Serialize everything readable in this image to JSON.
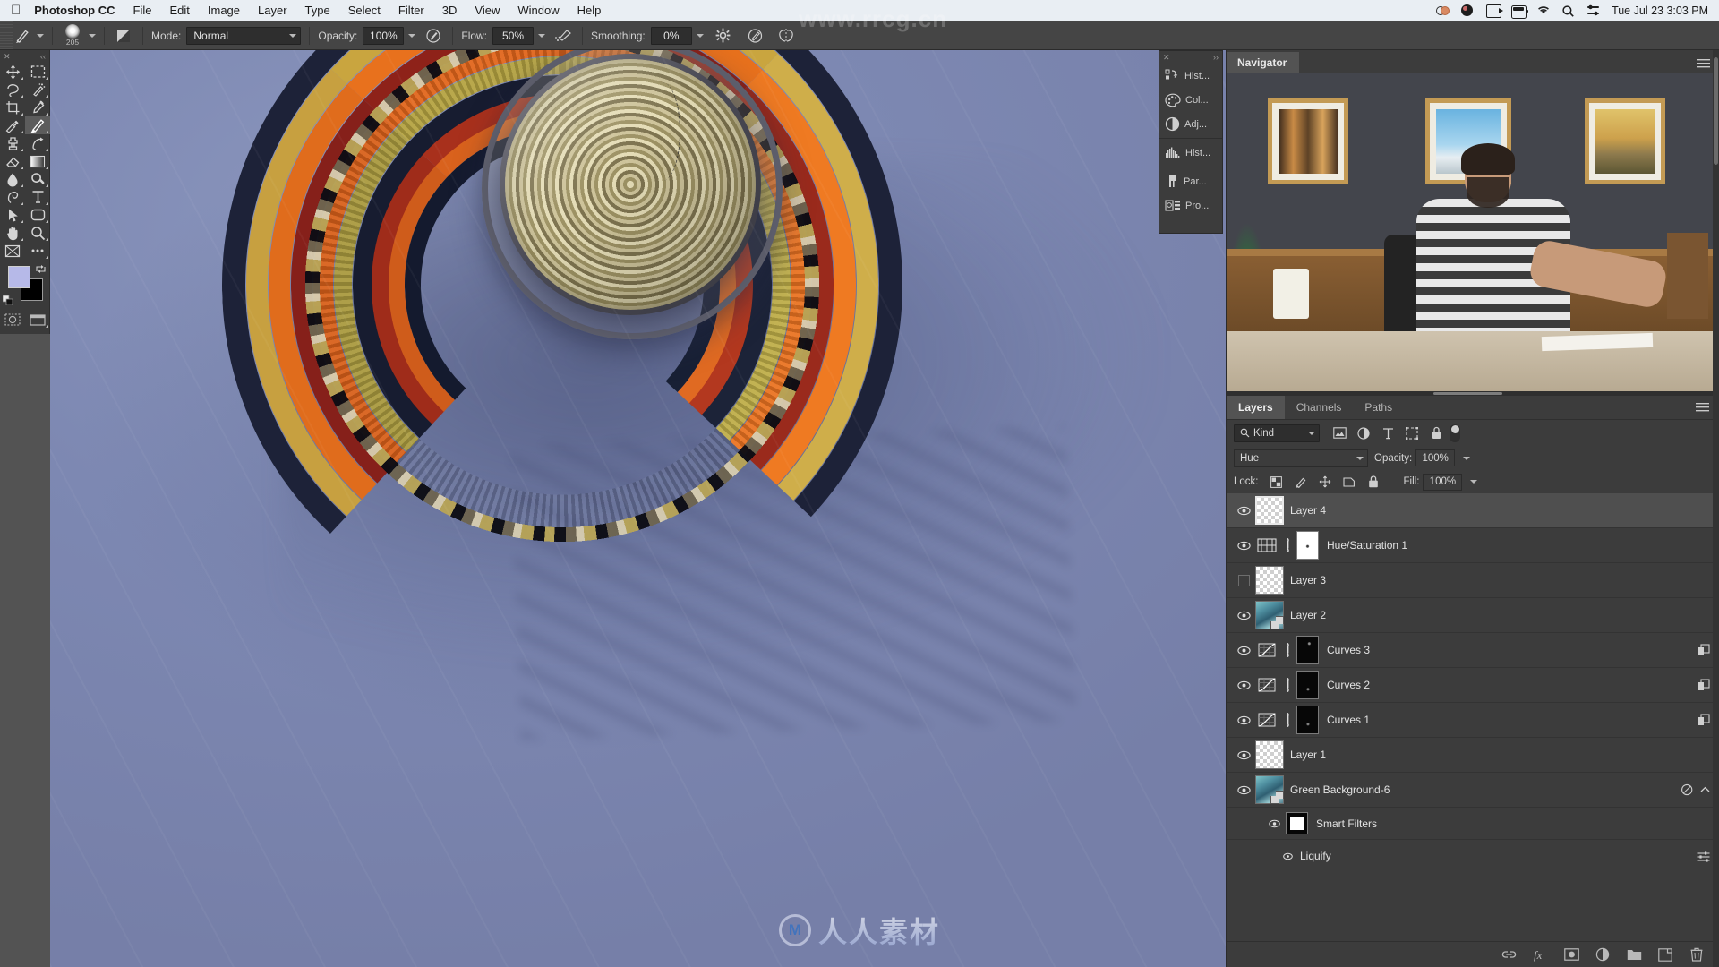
{
  "menubar": {
    "app_name": "Photoshop CC",
    "items": [
      "File",
      "Edit",
      "Image",
      "Layer",
      "Type",
      "Select",
      "Filter",
      "3D",
      "View",
      "Window",
      "Help"
    ],
    "clock": "Tue Jul 23  3:03 PM",
    "status_icons": [
      "dropbox-icon",
      "colorsync-icon",
      "airplay-icon",
      "battery-icon",
      "wifi-icon",
      "search-icon",
      "control-center-icon"
    ]
  },
  "options_bar": {
    "tool_icon": "brush-tool-icon",
    "brush_size": "205",
    "mode_label": "Mode:",
    "mode_value": "Normal",
    "opacity_label": "Opacity:",
    "opacity_value": "100%",
    "airbrush_icon": "airbrush-pressure-icon",
    "flow_label": "Flow:",
    "flow_value": "50%",
    "smoothing_toggle_icon": "smoothing-toggle-icon",
    "smoothing_label": "Smoothing:",
    "smoothing_value": "0%",
    "settings_icon": "gear-icon",
    "tablet_pressure_icon": "tablet-pressure-icon",
    "symmetry_icon": "symmetry-butterfly-icon"
  },
  "toolbar": {
    "tools": [
      {
        "name": "move-tool",
        "icon": "move-icon"
      },
      {
        "name": "rectangular-marquee-tool",
        "icon": "marquee-icon"
      },
      {
        "name": "lasso-tool",
        "icon": "lasso-icon"
      },
      {
        "name": "quick-selection-tool",
        "icon": "magic-wand-icon"
      },
      {
        "name": "crop-tool",
        "icon": "crop-icon"
      },
      {
        "name": "eyedropper-tool",
        "icon": "eyedropper-icon"
      },
      {
        "name": "spot-healing-brush-tool",
        "icon": "healing-brush-icon"
      },
      {
        "name": "brush-tool",
        "icon": "brush-icon"
      },
      {
        "name": "clone-stamp-tool",
        "icon": "clone-stamp-icon"
      },
      {
        "name": "history-brush-tool",
        "icon": "history-brush-icon"
      },
      {
        "name": "eraser-tool",
        "icon": "eraser-icon"
      },
      {
        "name": "gradient-tool",
        "icon": "gradient-icon"
      },
      {
        "name": "blur-tool",
        "icon": "blur-drop-icon"
      },
      {
        "name": "dodge-tool",
        "icon": "dodge-icon"
      },
      {
        "name": "pen-tool",
        "icon": "pen-icon"
      },
      {
        "name": "type-tool",
        "icon": "type-t-icon"
      },
      {
        "name": "path-selection-tool",
        "icon": "path-arrow-icon"
      },
      {
        "name": "rectangle-tool",
        "icon": "rounded-rect-icon"
      },
      {
        "name": "hand-tool",
        "icon": "hand-icon"
      },
      {
        "name": "zoom-tool",
        "icon": "magnifier-icon"
      },
      {
        "name": "edit-toolbar",
        "icon": "toolbar-edit-icon"
      },
      {
        "name": "more-tools",
        "icon": "ellipsis-icon"
      }
    ],
    "active_tool": "brush-tool",
    "foreground_color": "#b6b9e8",
    "background_color": "#000000",
    "quick-mask-icon": "quick-mask-icon",
    "screen-mode-icon": "screen-mode-icon"
  },
  "dock": {
    "items": [
      {
        "label": "Hist...",
        "name": "history-panel-icon"
      },
      {
        "label": "Col...",
        "name": "color-panel-icon"
      },
      {
        "label": "Adj...",
        "name": "adjustments-panel-icon"
      },
      {
        "label": "Hist...",
        "name": "histogram-panel-icon"
      },
      {
        "label": "Par...",
        "name": "paragraph-panel-icon"
      },
      {
        "label": "Pro...",
        "name": "properties-panel-icon"
      }
    ]
  },
  "navigator": {
    "tab_label": "Navigator",
    "menu_icon": "panel-menu-icon"
  },
  "layers_panel": {
    "tabs": [
      {
        "label": "Layers",
        "active": true
      },
      {
        "label": "Channels",
        "active": false
      },
      {
        "label": "Paths",
        "active": false
      }
    ],
    "menu_icon": "panel-menu-icon",
    "filter_label": "Kind",
    "filter_icons": [
      "pixel-filter-icon",
      "adjustment-filter-icon",
      "type-filter-icon",
      "shape-filter-icon",
      "smartobject-filter-icon"
    ],
    "blend_mode": "Hue",
    "opacity_label": "Opacity:",
    "opacity_value": "100%",
    "lock_label": "Lock:",
    "lock_icons": [
      "lock-transparent-icon",
      "lock-image-icon",
      "lock-position-icon",
      "lock-artboard-icon",
      "lock-all-icon"
    ],
    "fill_label": "Fill:",
    "fill_value": "100%",
    "layers": [
      {
        "name": "Layer 4",
        "visible": true,
        "selected": true,
        "type": "pixel",
        "thumb": "transparent"
      },
      {
        "name": "Hue/Saturation 1",
        "visible": true,
        "selected": false,
        "type": "adjustment",
        "adj_icon": "hue-saturation-icon",
        "mask": "white"
      },
      {
        "name": "Layer 3",
        "visible": false,
        "selected": false,
        "type": "pixel",
        "thumb": "transparent"
      },
      {
        "name": "Layer 2",
        "visible": true,
        "selected": false,
        "type": "smart",
        "thumb": "photo"
      },
      {
        "name": "Curves 3",
        "visible": true,
        "selected": false,
        "type": "adjustment",
        "adj_icon": "curves-icon",
        "mask": "black",
        "clipped": true
      },
      {
        "name": "Curves 2",
        "visible": true,
        "selected": false,
        "type": "adjustment",
        "adj_icon": "curves-icon",
        "mask": "black",
        "clipped": true
      },
      {
        "name": "Curves 1",
        "visible": true,
        "selected": false,
        "type": "adjustment",
        "adj_icon": "curves-icon",
        "mask": "black",
        "clipped": true
      },
      {
        "name": "Layer 1",
        "visible": true,
        "selected": false,
        "type": "pixel",
        "thumb": "transparent"
      },
      {
        "name": "Green Background-6",
        "visible": true,
        "selected": false,
        "type": "smart",
        "thumb": "photo",
        "has_smart_filters": true
      }
    ],
    "smart_filters_label": "Smart Filters",
    "smart_filter_items": [
      "Liquify"
    ],
    "footer_buttons": [
      {
        "name": "link-layers-button",
        "icon": "link-icon"
      },
      {
        "name": "layer-style-button",
        "icon": "fx-icon"
      },
      {
        "name": "add-layer-mask-button",
        "icon": "mask-icon"
      },
      {
        "name": "new-adjustment-layer-button",
        "icon": "half-circle-icon"
      },
      {
        "name": "new-group-button",
        "icon": "folder-icon"
      },
      {
        "name": "new-layer-button",
        "icon": "new-layer-icon"
      },
      {
        "name": "delete-layer-button",
        "icon": "trash-icon"
      }
    ]
  },
  "watermarks": {
    "url": "www.rrcg.cn",
    "brand": "人人素材",
    "logo_letter": "M"
  }
}
